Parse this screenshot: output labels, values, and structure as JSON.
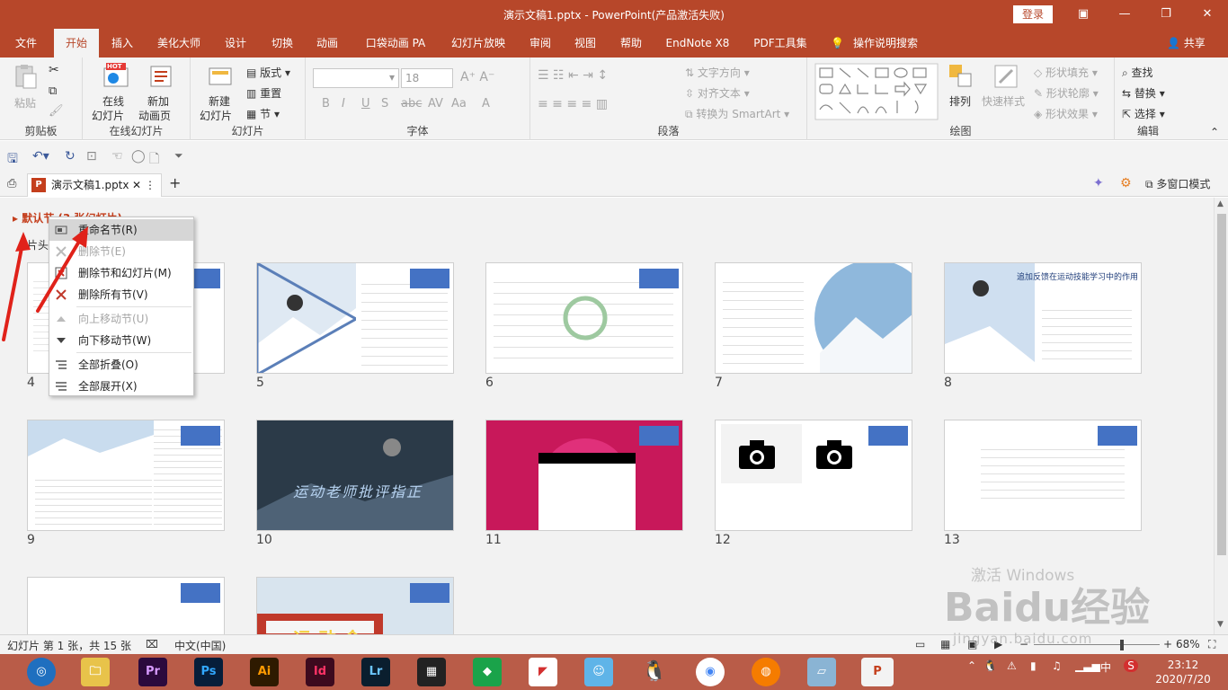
{
  "titlebar": {
    "title": "演示文稿1.pptx  -  PowerPoint(产品激活失败)",
    "login": "登录",
    "minimize": "—",
    "restore": "❐",
    "close": "✕"
  },
  "tabs": [
    "文件",
    "开始",
    "插入",
    "美化大师",
    "设计",
    "切换",
    "动画",
    "口袋动画 PA",
    "幻灯片放映",
    "审阅",
    "视图",
    "帮助",
    "EndNote X8",
    "PDF工具集",
    "操作说明搜索"
  ],
  "share": "共享",
  "ribbon": {
    "clipboard": {
      "label": "剪贴板",
      "paste": "粘贴"
    },
    "online": {
      "label": "在线幻灯片",
      "b1a": "在线",
      "b1b": "幻灯片",
      "b2a": "新加",
      "b2b": "动画页",
      "hot": "HOT"
    },
    "slides": {
      "label": "幻灯片",
      "new_a": "新建",
      "new_b": "幻灯片",
      "layout": "版式",
      "reset": "重置",
      "section": "节"
    },
    "font": {
      "label": "字体",
      "size": "18"
    },
    "paragraph": {
      "label": "段落",
      "text_dir": "文字方向",
      "align_text": "对齐文本",
      "smartart": "转换为 SmartArt"
    },
    "drawing": {
      "label": "绘图",
      "arrange": "排列",
      "quick_styles": "快速样式",
      "fill": "形状填充",
      "outline": "形状轮廓",
      "effects": "形状效果"
    },
    "editing": {
      "label": "编辑",
      "find": "查找",
      "replace": "替换",
      "select": "选择"
    }
  },
  "doctabs": {
    "file": "演示文稿1.pptx",
    "multiwindow": "多窗口模式"
  },
  "sorter": {
    "section_title": "默认节 (3 张幻灯片)",
    "section_sub": "片头",
    "numbers": [
      "4",
      "5",
      "6",
      "7",
      "8",
      "9",
      "10",
      "11",
      "12",
      "13"
    ],
    "slide8_title": "追加反馈在运动技能学习中的作用",
    "slide10_title": "运动老师批评指正",
    "slide15_title": "运动会"
  },
  "context_menu": {
    "items": [
      {
        "label": "重命名节(R)",
        "state": "highlight"
      },
      {
        "label": "删除节(E)",
        "state": "disabled"
      },
      {
        "label": "删除节和幻灯片(M)",
        "state": "normal"
      },
      {
        "label": "删除所有节(V)",
        "state": "normal"
      },
      {
        "label": "向上移动节(U)",
        "state": "disabled"
      },
      {
        "label": "向下移动节(W)",
        "state": "normal"
      },
      {
        "label": "全部折叠(O)",
        "state": "normal"
      },
      {
        "label": "全部展开(X)",
        "state": "normal"
      }
    ]
  },
  "status": {
    "slide_info": "幻灯片 第 1 张，共 15 张",
    "language": "中文(中国)",
    "zoom": "68%"
  },
  "watermark": {
    "brand": "Baidu经验",
    "url": "jingyan.baidu.com",
    "activate": "激活 Windows"
  },
  "taskbar": {
    "apps": [
      "Pr",
      "Ps",
      "Ai",
      "Id",
      "Lr"
    ],
    "time": "23:12",
    "date": "2020/7/20",
    "ime": "中"
  },
  "colors": {
    "accent": "#b7472a",
    "section": "#c43e1c",
    "placeholder_blue": "#4472c4"
  }
}
